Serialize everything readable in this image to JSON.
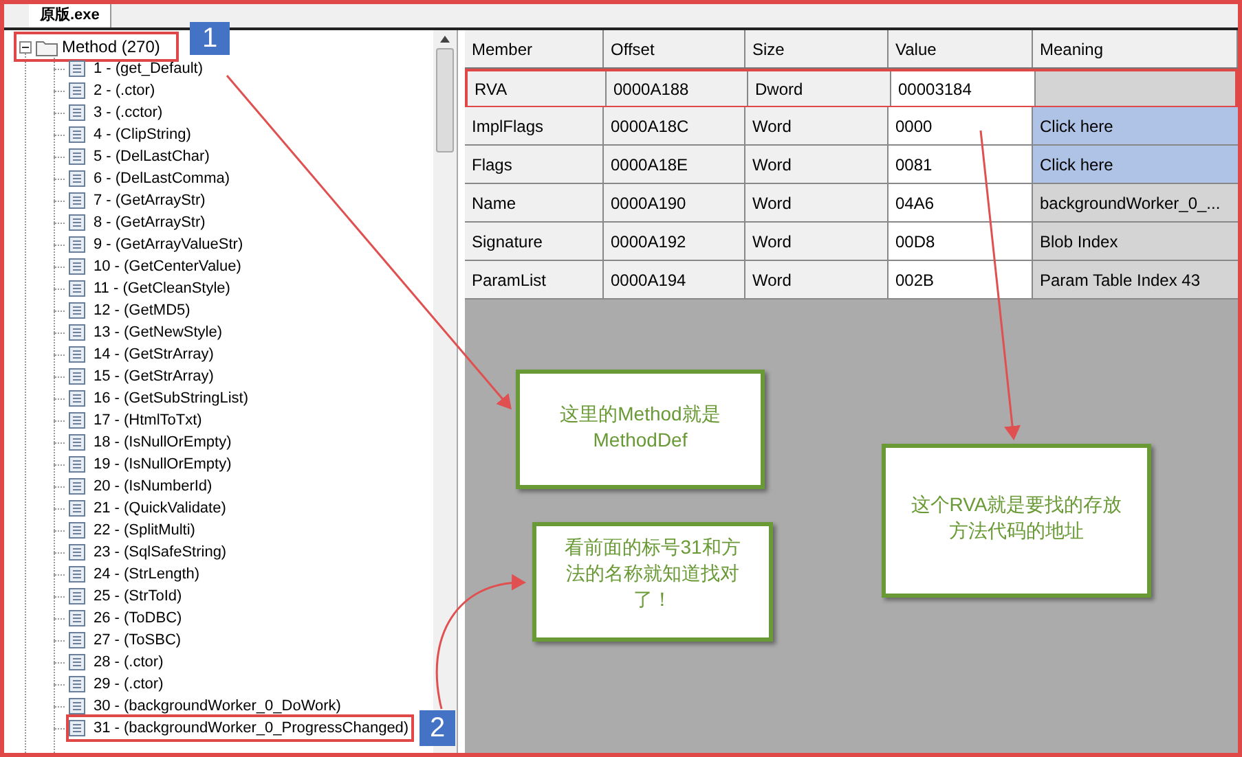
{
  "tab": {
    "label": "原版.exe",
    "selected": true
  },
  "tree": {
    "label": "Method (270)",
    "expanded": true,
    "highlighted": true,
    "badge": "1",
    "children": [
      {
        "label": "1 - (get_Default)",
        "highlighted": false
      },
      {
        "label": "2 - (.ctor)",
        "highlighted": false
      },
      {
        "label": "3 - (.cctor)",
        "highlighted": false
      },
      {
        "label": "4 - (ClipString)",
        "highlighted": false
      },
      {
        "label": "5 - (DelLastChar)",
        "highlighted": false
      },
      {
        "label": "6 - (DelLastComma)",
        "highlighted": false
      },
      {
        "label": "7 - (GetArrayStr)",
        "highlighted": false
      },
      {
        "label": "8 - (GetArrayStr)",
        "highlighted": false
      },
      {
        "label": "9 - (GetArrayValueStr)",
        "highlighted": false
      },
      {
        "label": "10 - (GetCenterValue)",
        "highlighted": false
      },
      {
        "label": "11 - (GetCleanStyle)",
        "highlighted": false
      },
      {
        "label": "12 - (GetMD5)",
        "highlighted": false
      },
      {
        "label": "13 - (GetNewStyle)",
        "highlighted": false
      },
      {
        "label": "14 - (GetStrArray)",
        "highlighted": false
      },
      {
        "label": "15 - (GetStrArray)",
        "highlighted": false
      },
      {
        "label": "16 - (GetSubStringList)",
        "highlighted": false
      },
      {
        "label": "17 - (HtmlToTxt)",
        "highlighted": false
      },
      {
        "label": "18 - (IsNullOrEmpty)",
        "highlighted": false
      },
      {
        "label": "19 - (IsNullOrEmpty)",
        "highlighted": false
      },
      {
        "label": "20 - (IsNumberId)",
        "highlighted": false
      },
      {
        "label": "21 - (QuickValidate)",
        "highlighted": false
      },
      {
        "label": "22 - (SplitMulti)",
        "highlighted": false
      },
      {
        "label": "23 - (SqlSafeString)",
        "highlighted": false
      },
      {
        "label": "24 - (StrLength)",
        "highlighted": false
      },
      {
        "label": "25 - (StrToId)",
        "highlighted": false
      },
      {
        "label": "26 - (ToDBC)",
        "highlighted": false
      },
      {
        "label": "27 - (ToSBC)",
        "highlighted": false
      },
      {
        "label": "28 - (.ctor)",
        "highlighted": false
      },
      {
        "label": "29 - (.ctor)",
        "highlighted": false
      },
      {
        "label": "30 - (backgroundWorker_0_DoWork)",
        "highlighted": false
      },
      {
        "label": "31 - (backgroundWorker_0_ProgressChanged)",
        "highlighted": true,
        "badge": "2"
      }
    ]
  },
  "table": {
    "columns": [
      "Member",
      "Offset",
      "Size",
      "Value",
      "Meaning"
    ],
    "rows": [
      {
        "cells": [
          "RVA",
          "0000A188",
          "Dword",
          "00003184"
        ],
        "meaning": {
          "kind": "text"
        },
        "highlighted": true
      },
      {
        "cells": [
          "ImplFlags",
          "0000A18C",
          "Word",
          "0000"
        ],
        "meaning": {
          "kind": "link",
          "text": "Click here"
        },
        "highlighted": false
      },
      {
        "cells": [
          "Flags",
          "0000A18E",
          "Word",
          "0081"
        ],
        "meaning": {
          "kind": "link",
          "text": "Click here"
        },
        "highlighted": false
      },
      {
        "cells": [
          "Name",
          "0000A190",
          "Word",
          "04A6"
        ],
        "meaning": {
          "kind": "text",
          "text": "backgroundWorker_0_..."
        },
        "highlighted": false
      },
      {
        "cells": [
          "Signature",
          "0000A192",
          "Word",
          "00D8"
        ],
        "meaning": {
          "kind": "text",
          "text": "Blob Index"
        },
        "highlighted": false
      },
      {
        "cells": [
          "ParamList",
          "0000A194",
          "Word",
          "002B"
        ],
        "meaning": {
          "kind": "text",
          "text": "Param Table Index 43"
        },
        "highlighted": false
      }
    ]
  },
  "callouts": [
    "这里的Method就是MethodDef",
    "看前面的标号31和方法的名称就知道找对了！",
    "这个RVA就是要找的存放方法代码的地址"
  ]
}
